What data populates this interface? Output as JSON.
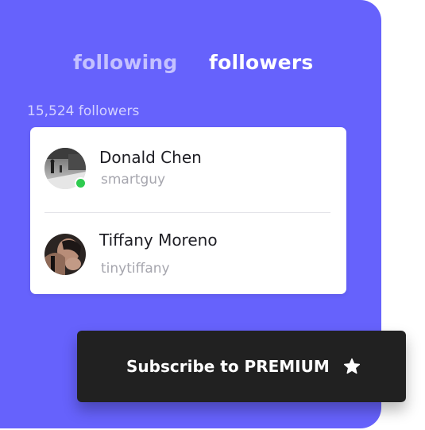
{
  "tabs": {
    "following": "following",
    "followers": "followers",
    "active": "followers"
  },
  "followers_count": "15,524 followers",
  "users": [
    {
      "name": "Donald Chen",
      "handle": "smartguy",
      "online": true
    },
    {
      "name": "Tiffany Moreno",
      "handle": "tinytiffany",
      "online": false
    }
  ],
  "subscribe": {
    "label": "Subscribe to PREMIUM",
    "icon": "star-icon"
  },
  "colors": {
    "panel": "#6662fc",
    "online": "#2ecb4f",
    "button": "#212121"
  }
}
